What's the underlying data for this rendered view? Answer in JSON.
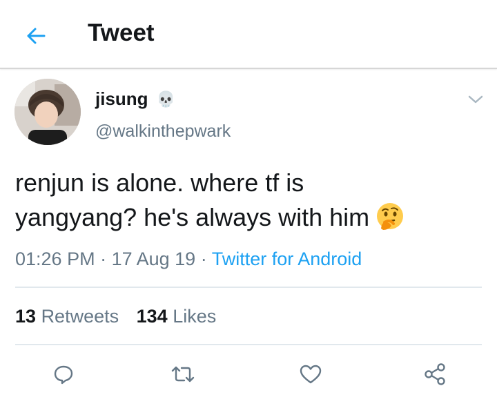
{
  "header": {
    "title": "Tweet",
    "back_icon": "arrow-left-icon"
  },
  "tweet": {
    "author_name": "jisung",
    "author_emoji": "💀",
    "handle": "@walkinthepwark",
    "text_line1": "renjun is alone. where tf is",
    "text_line2": "yangyang? he's always with him",
    "emoji": "thinking-face-icon",
    "time": "01:26 PM",
    "sep1": " · ",
    "date": "17 Aug 19",
    "sep2": " · ",
    "source": "Twitter for Android"
  },
  "stats": {
    "retweets_count": "13",
    "retweets_label": "Retweets",
    "likes_count": "134",
    "likes_label": "Likes"
  },
  "actions": [
    "reply-icon",
    "retweet-icon",
    "like-icon",
    "share-icon"
  ],
  "colors": {
    "accent": "#1da1f2",
    "secondary": "#657786",
    "text": "#14171a"
  }
}
